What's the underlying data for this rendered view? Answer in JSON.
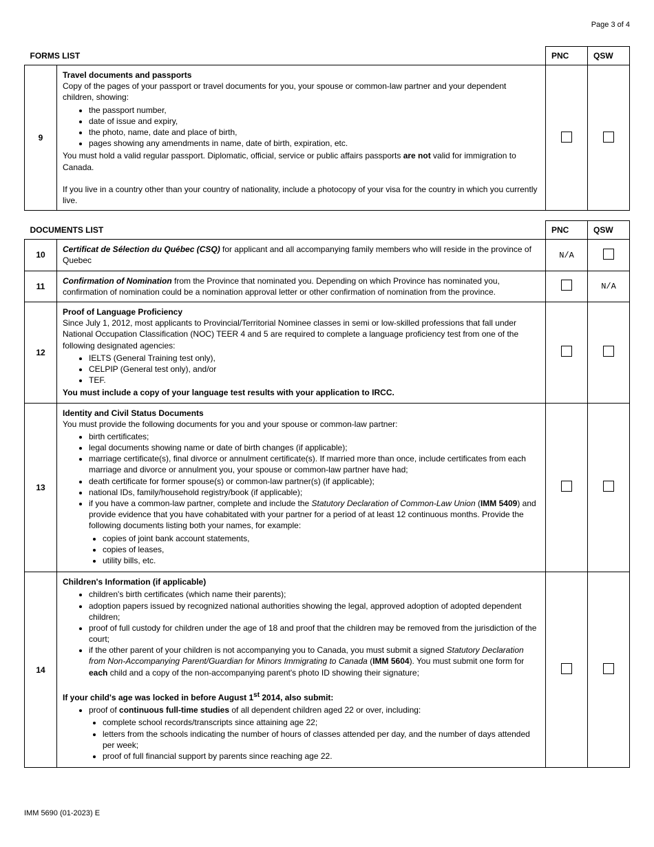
{
  "page": {
    "label": "Page 3 of 4"
  },
  "footer": {
    "code": "IMM 5690 (01-2023) E"
  },
  "formsList": {
    "header": "FORMS LIST",
    "colPnc": "PNC",
    "colQsw": "QSW",
    "row9": {
      "num": "9",
      "title": "Travel documents and passports",
      "intro": "Copy of the pages of your passport or travel documents for you, your spouse or common-law partner and your dependent children, showing:",
      "b1": "the passport number,",
      "b2": "date of issue and expiry,",
      "b3": "the photo, name, date and place of birth,",
      "b4": "pages showing any amendments in name, date of birth, expiration, etc.",
      "p2a": "You must hold a valid regular passport. Diplomatic, official, service or public affairs passports ",
      "p2b": "are not",
      "p2c": " valid for immigration to Canada.",
      "p3": "If you live in a country other than your country of nationality, include a photocopy of your visa for the country in which you currently live."
    }
  },
  "docsList": {
    "header": "DOCUMENTS LIST",
    "colPnc": "PNC",
    "colQsw": "QSW",
    "row10": {
      "num": "10",
      "titleItalic": "Certificat de Sélection du Québec (CSQ)",
      "rest": " for applicant and all accompanying family members who will reside in the province of Quebec",
      "pnc": "N/A"
    },
    "row11": {
      "num": "11",
      "titleItalic": "Confirmation of Nomination",
      "rest": " from the Province that nominated you. Depending on which Province has nominated you, confirmation of nomination could be a nomination approval letter or other confirmation of nomination from the province.",
      "qsw": "N/A"
    },
    "row12": {
      "num": "12",
      "title": "Proof of Language Proficiency",
      "p1": "Since July 1, 2012, most applicants to Provincial/Territorial Nominee classes in semi or low-skilled professions that fall under National Occupation Classification (NOC) TEER 4 and 5 are required to complete a language proficiency test from one of the following designated agencies:",
      "b1": "IELTS (General Training test only),",
      "b2": "CELPIP (General test only), and/or",
      "b3": "TEF.",
      "p2": "You must include a copy of your language test results with your application to IRCC."
    },
    "row13": {
      "num": "13",
      "title": "Identity and Civil Status Documents",
      "p1": "You must provide the following documents for you and your spouse or common-law partner:",
      "b1": "birth certificates;",
      "b2": "legal documents showing name or date of birth changes (if applicable);",
      "b3": "marriage certificate(s), final divorce or annulment certificate(s). If married more than once, include certificates from each marriage and divorce or annulment you, your spouse or common-law partner have had;",
      "b4": "death certificate for former spouse(s) or common-law partner(s) (if applicable);",
      "b5": "national IDs, family/household registry/book (if applicable);",
      "b6a": "if you have a common-law partner, complete and include the ",
      "b6i": "Statutory Declaration of Common-Law Union",
      "b6b": " (",
      "b6bold": "IMM 5409",
      "b6c": ") and provide evidence that you have cohabitated with your partner for a period of at least 12 continuous months. Provide the following documents listing both your names, for example:",
      "s1": "copies of joint bank account statements,",
      "s2": "copies of leases,",
      "s3": "utility bills, etc."
    },
    "row14": {
      "num": "14",
      "title": "Children's Information (if applicable)",
      "b1": "children's birth certificates (which name their parents);",
      "b2": "adoption papers issued by recognized national authorities showing the legal, approved adoption of adopted dependent children;",
      "b3": "proof of full custody for children under the age of 18 and proof that the children may be removed from the jurisdiction of the court;",
      "b4a": "if the other parent of your children is not accompanying you to Canada, you must submit a signed ",
      "b4i": "Statutory Declaration from Non-Accompanying Parent/Guardian for Minors Immigrating to Canada",
      "b4b": " (",
      "b4bold": "IMM 5604",
      "b4c": "). You must submit one form for ",
      "b4d": "each",
      "b4e": " child and a copy of the non-accompanying parent's photo ID showing their signature;",
      "p2a": "If your child's age was locked in before August 1",
      "p2sup": "st",
      "p2b": " 2014, also submit:",
      "c1a": "proof of ",
      "c1b": "continuous full-time studies",
      "c1c": " of all dependent children aged 22 or over, including:",
      "s1": "complete school records/transcripts since attaining age 22;",
      "s2": "letters from the schools indicating the number of hours of classes attended per day, and the number of days attended per week;",
      "s3": "proof of full financial support by parents since reaching age 22."
    }
  }
}
